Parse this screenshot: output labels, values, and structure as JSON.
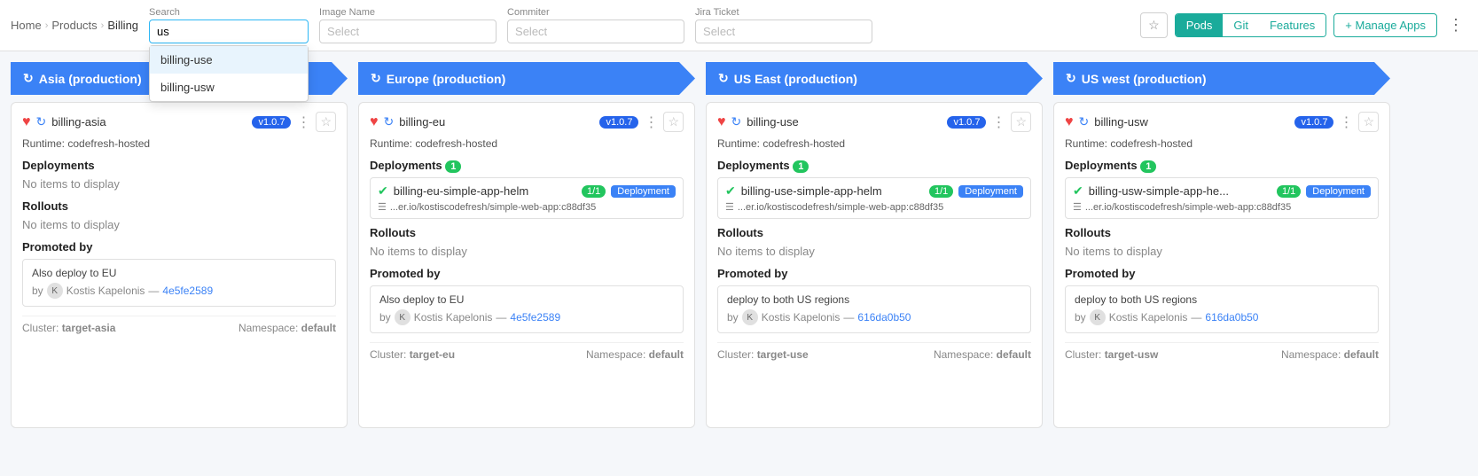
{
  "breadcrumb": {
    "home": "Home",
    "products": "Products",
    "current": "Billing"
  },
  "toolbar": {
    "search_label": "Search",
    "search_value": "us",
    "image_name_label": "Image Name",
    "image_name_placeholder": "Select",
    "committer_label": "Commiter",
    "committer_placeholder": "Select",
    "jira_label": "Jira Ticket",
    "jira_placeholder": "Select",
    "manage_apps_label": "+ Manage Apps",
    "tabs": [
      "Pods",
      "Git",
      "Features"
    ],
    "active_tab": "Pods"
  },
  "autocomplete": {
    "items": [
      "billing-use",
      "billing-usw"
    ]
  },
  "columns": [
    {
      "id": "asia",
      "header": "Asia (production)",
      "header_color": "blue",
      "app": {
        "name": "billing-asia",
        "version": "v1.0.7",
        "runtime": "codefresh-hosted"
      },
      "deployments": {
        "count": 0,
        "items": []
      },
      "rollouts": {
        "items": []
      },
      "promoted_by": {
        "label": "Also deploy to EU",
        "author": "Kostis Kapelonis",
        "commit": "4e5fe2589"
      },
      "cluster": "target-asia",
      "namespace": "default"
    },
    {
      "id": "europe",
      "header": "Europe (production)",
      "header_color": "blue",
      "app": {
        "name": "billing-eu",
        "version": "v1.0.7",
        "runtime": "codefresh-hosted"
      },
      "deployments": {
        "count": 1,
        "items": [
          {
            "name": "billing-eu-simple-app-helm",
            "count": "1/1",
            "tag": "Deployment",
            "image": "...er.io/kostiscodefresh/simple-web-app:c88df35"
          }
        ]
      },
      "rollouts": {
        "items": []
      },
      "promoted_by": {
        "label": "Also deploy to EU",
        "author": "Kostis Kapelonis",
        "commit": "4e5fe2589"
      },
      "cluster": "target-eu",
      "namespace": "default"
    },
    {
      "id": "us-east",
      "header": "US East (production)",
      "header_color": "blue",
      "app": {
        "name": "billing-use",
        "version": "v1.0.7",
        "runtime": "codefresh-hosted"
      },
      "deployments": {
        "count": 1,
        "items": [
          {
            "name": "billing-use-simple-app-helm",
            "count": "1/1",
            "tag": "Deployment",
            "image": "...er.io/kostiscodefresh/simple-web-app:c88df35"
          }
        ]
      },
      "rollouts": {
        "items": []
      },
      "promoted_by": {
        "label": "deploy to both US regions",
        "author": "Kostis Kapelonis",
        "commit": "616da0b50"
      },
      "cluster": "target-use",
      "namespace": "default"
    },
    {
      "id": "us-west",
      "header": "US west (production)",
      "header_color": "blue",
      "app": {
        "name": "billing-usw",
        "version": "v1.0.7",
        "runtime": "codefresh-hosted"
      },
      "deployments": {
        "count": 1,
        "items": [
          {
            "name": "billing-usw-simple-app-he...",
            "count": "1/1",
            "tag": "Deployment",
            "image": "...er.io/kostiscodefresh/simple-web-app:c88df35"
          }
        ]
      },
      "rollouts": {
        "items": []
      },
      "promoted_by": {
        "label": "deploy to both US regions",
        "author": "Kostis Kapelonis",
        "commit": "616da0b50"
      },
      "cluster": "target-usw",
      "namespace": "default"
    }
  ],
  "labels": {
    "deployments": "Deployments",
    "rollouts": "Rollouts",
    "no_items": "No items to display",
    "promoted_by": "Promoted by",
    "runtime_prefix": "Runtime:",
    "cluster_prefix": "Cluster:",
    "namespace_prefix": "Namespace:",
    "by": "by",
    "dash": "—"
  }
}
